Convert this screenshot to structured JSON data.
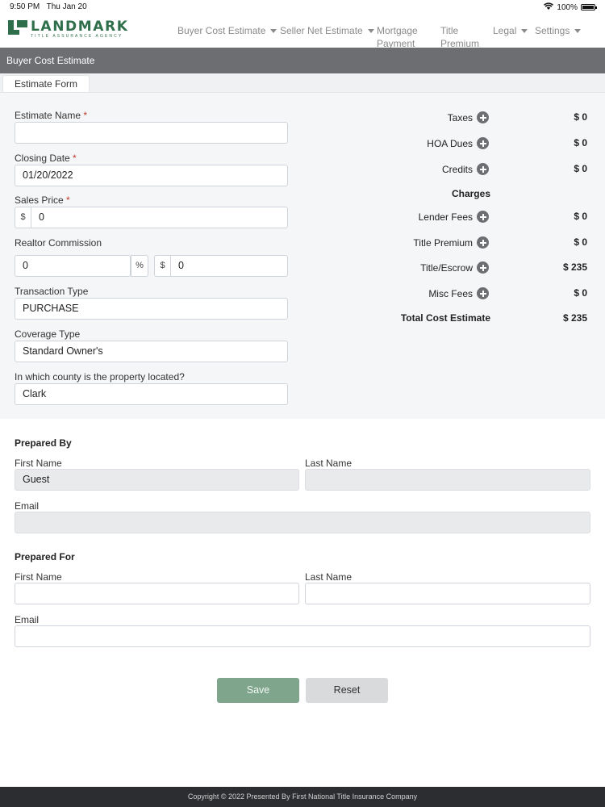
{
  "status_bar": {
    "time": "9:50 PM",
    "date": "Thu Jan 20",
    "battery": "100%"
  },
  "brand": {
    "name": "LANDMARK",
    "tagline": "TITLE ASSURANCE AGENCY",
    "color": "#2e6e4a"
  },
  "nav": {
    "buyer_cost": "Buyer Cost Estimate",
    "seller_net": "Seller Net Estimate",
    "mortgage_line1": "Mortgage",
    "mortgage_line2": "Payment",
    "title_line1": "Title",
    "title_line2": "Premium",
    "legal": "Legal",
    "settings": "Settings"
  },
  "page": {
    "title": "Buyer Cost Estimate",
    "tab": "Estimate Form"
  },
  "form": {
    "estimate_name": {
      "label": "Estimate Name",
      "value": ""
    },
    "closing_date": {
      "label": "Closing Date",
      "value": "01/20/2022"
    },
    "sales_price": {
      "label": "Sales Price",
      "currency": "$",
      "value": "0"
    },
    "realtor_commission": {
      "label": "Realtor Commission",
      "percent": "0",
      "percent_sign": "%",
      "currency": "$",
      "amount": "0"
    },
    "transaction_type": {
      "label": "Transaction Type",
      "value": "PURCHASE"
    },
    "coverage_type": {
      "label": "Coverage Type",
      "value": "Standard Owner's"
    },
    "county": {
      "label": "In which county is the property located?",
      "value": "Clark"
    },
    "required_mark": "*"
  },
  "summary": {
    "taxes": {
      "label": "Taxes",
      "value": "$ 0"
    },
    "hoa": {
      "label": "HOA Dues",
      "value": "$ 0"
    },
    "credits": {
      "label": "Credits",
      "value": "$ 0"
    },
    "charges_heading": "Charges",
    "lender_fees": {
      "label": "Lender Fees",
      "value": "$ 0"
    },
    "title_premium": {
      "label": "Title Premium",
      "value": "$ 0"
    },
    "title_escrow": {
      "label": "Title/Escrow",
      "value": "$ 235"
    },
    "misc_fees": {
      "label": "Misc Fees",
      "value": "$ 0"
    },
    "total": {
      "label": "Total Cost Estimate",
      "value": "$ 235"
    }
  },
  "prepared_by": {
    "heading": "Prepared By",
    "first_name_label": "First Name",
    "first_name": "Guest",
    "last_name_label": "Last Name",
    "last_name": "",
    "email_label": "Email",
    "email": ""
  },
  "prepared_for": {
    "heading": "Prepared For",
    "first_name_label": "First Name",
    "first_name": "",
    "last_name_label": "Last Name",
    "last_name": "",
    "email_label": "Email",
    "email": ""
  },
  "buttons": {
    "save": "Save",
    "reset": "Reset"
  },
  "footer": {
    "text": "Copyright © 2022 Presented By First National Title Insurance Company"
  },
  "colors": {
    "header_bar": "#6c6e72",
    "save_button": "#7fa68d",
    "footer": "#2c2d30"
  }
}
